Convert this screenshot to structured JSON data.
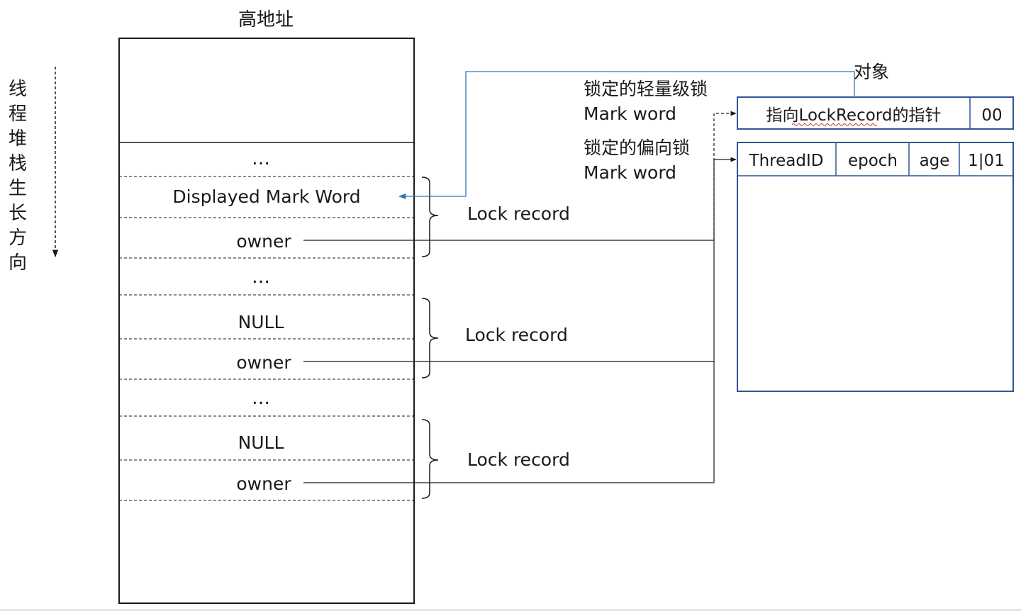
{
  "stack": {
    "top_label": "高地址",
    "growth_label": [
      "线",
      "程",
      "堆",
      "栈",
      "生",
      "长",
      "方",
      "向"
    ],
    "cells": {
      "ellipsis_1": "…",
      "displayed_mark_word": "Displayed Mark Word",
      "owner_1": "owner",
      "ellipsis_2": "…",
      "null_1": "NULL",
      "owner_2": "owner",
      "ellipsis_3": "…",
      "null_2": "NULL",
      "owner_3": "owner"
    },
    "lock_records": [
      "Lock record",
      "Lock record",
      "Lock record"
    ]
  },
  "mark_word": {
    "lightweight_title": "锁定的轻量级锁",
    "lightweight_sub": "Mark word",
    "biased_title": "锁定的偏向锁",
    "biased_sub": "Mark word"
  },
  "object": {
    "label": "对象",
    "lightweight_fields": [
      "指向LockRecord的指针",
      "00"
    ],
    "biased_fields": [
      "ThreadID",
      "epoch",
      "age",
      "1|01"
    ]
  },
  "colors": {
    "pointer_line": "#2e75b6",
    "object_border": "#2f5597",
    "text": "#1a1a1a"
  }
}
